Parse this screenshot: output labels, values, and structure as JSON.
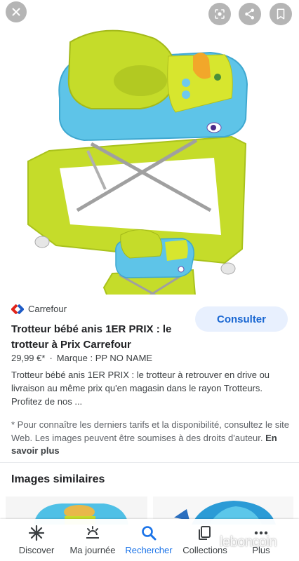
{
  "source": {
    "name": "Carrefour"
  },
  "result": {
    "title": "Trotteur bébé anis 1ER PRIX : le trotteur à Prix Carrefour",
    "price": "29,99 €*",
    "separator": "·",
    "brand": "Marque : PP NO NAME",
    "description": "Trotteur bébé anis 1ER PRIX : le trotteur à retrouver en drive ou livraison au même prix qu'en magasin dans le rayon Trotteurs. Profitez de nos ...",
    "notice": "* Pour connaître les derniers tarifs et la disponibilité, consultez le site Web. Les images peuvent être soumises à des droits d'auteur.",
    "learn_more": "En savoir plus",
    "consult_button": "Consulter"
  },
  "similar": {
    "title": "Images similaires"
  },
  "nav": {
    "items": [
      {
        "label": "Discover",
        "icon": "asterisk-icon"
      },
      {
        "label": "Ma journée",
        "icon": "journey-icon"
      },
      {
        "label": "Rechercher",
        "icon": "search-icon"
      },
      {
        "label": "Collections",
        "icon": "collections-icon"
      },
      {
        "label": "Plus",
        "icon": "more-icon"
      }
    ],
    "active": "Rechercher"
  },
  "watermark": "leboncoin",
  "colors": {
    "accent": "#1a73e8",
    "consult_bg": "#e8f0fe",
    "walker_green": "#c5dc2a",
    "walker_blue": "#5ec4e8",
    "carrefour_blue": "#1e5bc6",
    "carrefour_red": "#e1251b"
  }
}
